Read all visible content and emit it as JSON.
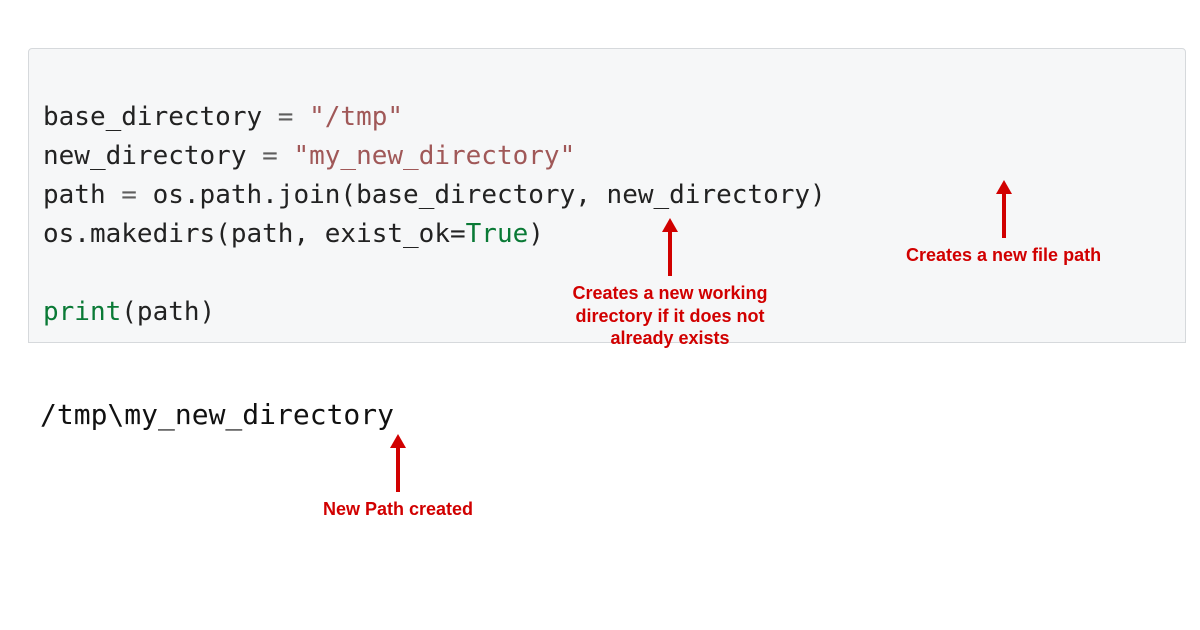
{
  "code": {
    "line1": {
      "var": "base_directory",
      "eq": " = ",
      "str": "\"/tmp\""
    },
    "line2": {
      "var": "new_directory",
      "eq": " = ",
      "str": "\"my_new_directory\""
    },
    "line3": {
      "var": "path",
      "eq": " = ",
      "call": "os.path.join(base_directory, new_directory)"
    },
    "line4": {
      "prefix": "os.makedirs(path, exist_ok=",
      "kw": "True",
      "suffix": ")"
    },
    "blank": " ",
    "line6": {
      "fn": "print",
      "args": "(path)"
    }
  },
  "output": "/tmp\\my_new_directory",
  "annotations": {
    "makedirs": "Creates a new working directory if it does not already exists",
    "join": "Creates a new file path",
    "newpath": "New Path created"
  }
}
